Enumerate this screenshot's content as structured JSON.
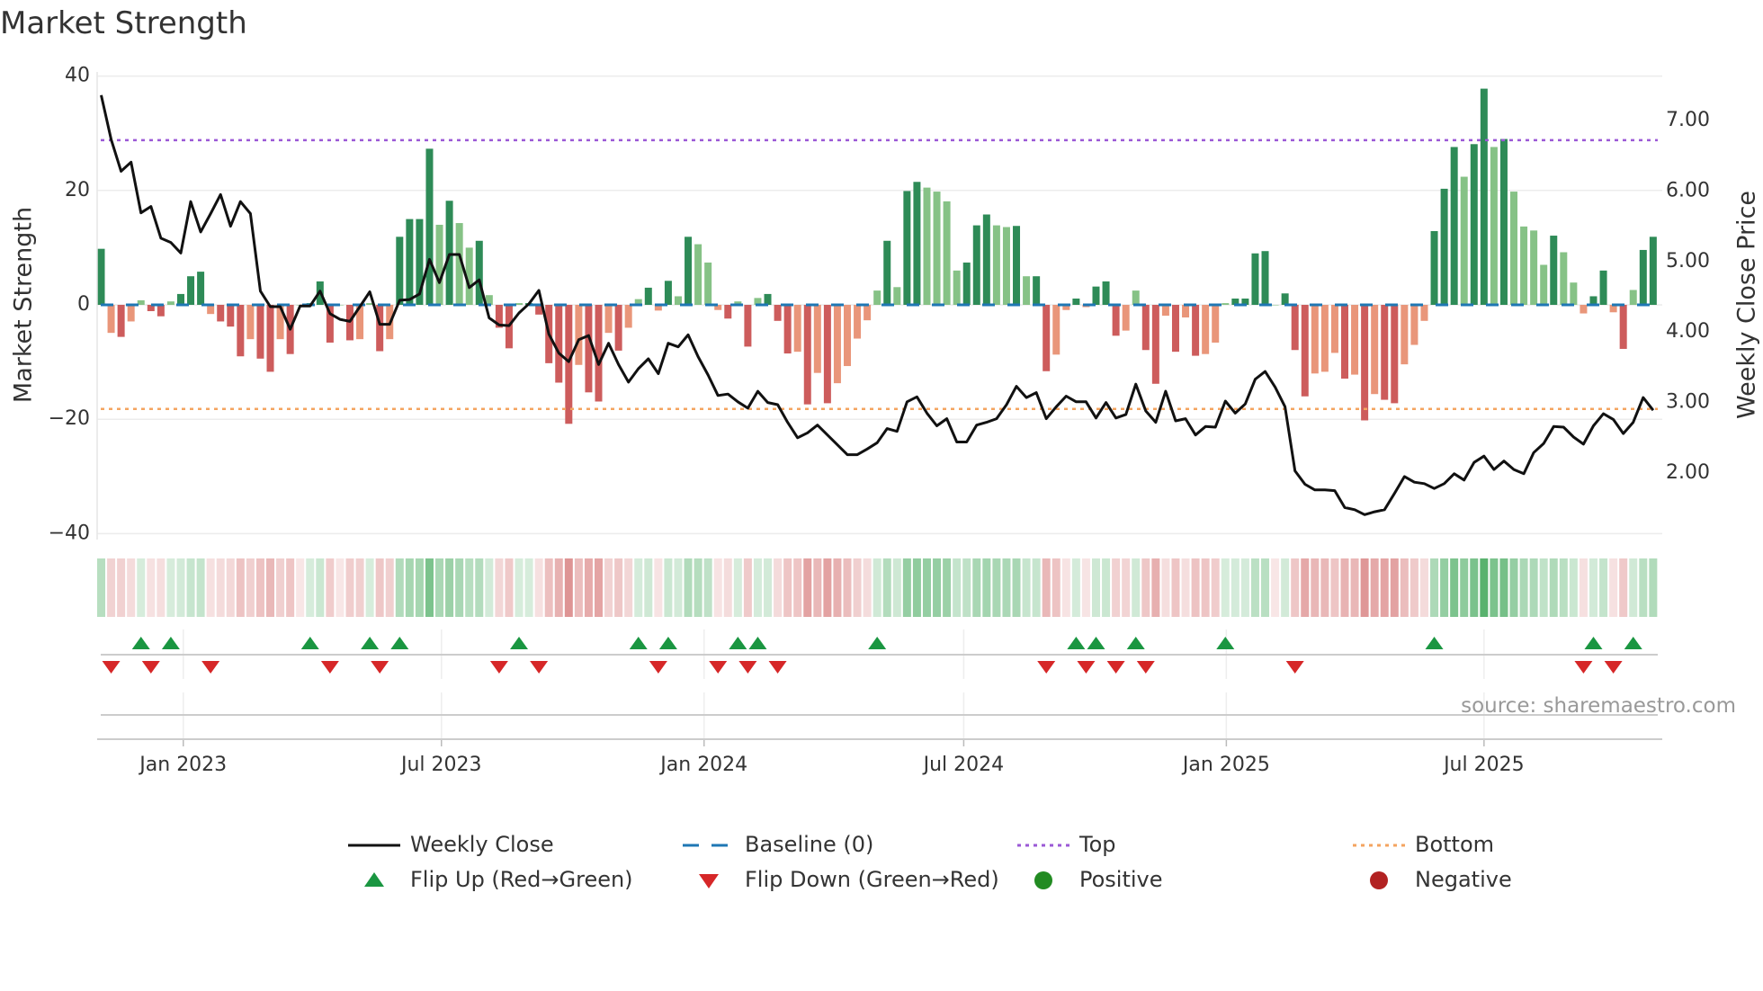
{
  "title": "Market Strength",
  "source": "source: sharemaestro.com",
  "colors": {
    "pos_dark": "#2e8b57",
    "pos_light": "#86c286",
    "neg_dark": "#cd5c5c",
    "neg_light": "#e9967a",
    "baseline": "#1f77b4",
    "top": "#9b59d6",
    "bottom": "#f4a460",
    "price": "#111111",
    "flip_up": "#1a9641",
    "flip_down": "#d62728",
    "positive": "#228b22",
    "negative": "#b22222"
  },
  "legend": [
    {
      "label": "Weekly Close",
      "kind": "line"
    },
    {
      "label": "Baseline (0)",
      "kind": "dash"
    },
    {
      "label": "Top",
      "kind": "dot-top"
    },
    {
      "label": "Bottom",
      "kind": "dot-bottom"
    },
    {
      "label": "Flip Up (Red→Green)",
      "kind": "tri-up"
    },
    {
      "label": "Flip Down (Green→Red)",
      "kind": "tri-down"
    },
    {
      "label": "Positive",
      "kind": "dot-pos"
    },
    {
      "label": "Negative",
      "kind": "dot-neg"
    }
  ],
  "chart_data": {
    "type": "bar",
    "title": "Market Strength",
    "ylabel": "Market Strength",
    "y2label": "Weekly Close Price",
    "ylim": [
      -40,
      40
    ],
    "y2lim": [
      1.0,
      7.5
    ],
    "yticks": [
      {
        "v": 40,
        "label": "40"
      },
      {
        "v": 20,
        "label": "20"
      },
      {
        "v": 0,
        "label": "0"
      },
      {
        "v": -20,
        "label": "−20"
      },
      {
        "v": -40,
        "label": "−40"
      }
    ],
    "y2ticks": [
      {
        "v": 7,
        "label": "7.00"
      },
      {
        "v": 6,
        "label": "6.00"
      },
      {
        "v": 5,
        "label": "5.00"
      },
      {
        "v": 4,
        "label": "4.00"
      },
      {
        "v": 3,
        "label": "3.00"
      },
      {
        "v": 2,
        "label": "2.00"
      }
    ],
    "xticks": [
      {
        "week": 9.25,
        "label": "Jan 2023"
      },
      {
        "week": 35.2,
        "label": "Jul 2023"
      },
      {
        "week": 61.6,
        "label": "Jan 2024"
      },
      {
        "week": 87.7,
        "label": "Jul 2024"
      },
      {
        "week": 114.1,
        "label": "Jan 2025"
      },
      {
        "week": 140.0,
        "label": "Jul 2025"
      }
    ],
    "top": 28.8,
    "bottom": -18.2,
    "baseline": 0,
    "strength": [
      9.8,
      -4.9,
      -5.6,
      -2.9,
      0.8,
      -1.1,
      -2,
      0.6,
      1.9,
      5,
      5.8,
      -1.6,
      -2.9,
      -3.8,
      -9,
      -6,
      -9.4,
      -11.7,
      -6,
      -8.6,
      0,
      0.3,
      4.1,
      -6.6,
      0,
      -6.2,
      -6,
      0.3,
      -8.1,
      -6,
      11.9,
      15,
      15,
      27.3,
      14,
      18.2,
      14.3,
      10,
      11.2,
      1.7,
      -4,
      -7.6,
      0.3,
      0.3,
      -1.7,
      -10.2,
      -13.6,
      -20.8,
      -10.5,
      -15.3,
      -16.9,
      -4.9,
      -8,
      -4,
      1,
      3,
      -1,
      4.2,
      1.5,
      11.9,
      10.6,
      7.4,
      -0.9,
      -2.4,
      0.6,
      -7.3,
      1.2,
      1.9,
      -2.8,
      -8.5,
      -8.2,
      -17.4,
      -11.9,
      -17.2,
      -13.7,
      -10.7,
      -5.9,
      -2.7,
      2.5,
      11.2,
      3.1,
      19.9,
      21.5,
      20.5,
      19.8,
      18.1,
      6,
      7.4,
      13.9,
      15.8,
      13.9,
      13.6,
      13.8,
      5,
      5,
      -11.6,
      -8.7,
      -0.9,
      1.1,
      -0.4,
      3.2,
      4.1,
      -5.4,
      -4.5,
      2.5,
      -7.9,
      -13.8,
      -1.9,
      -8.2,
      -2.2,
      -8.9,
      -8.6,
      -6.6,
      0.3,
      1.1,
      1.1,
      9,
      9.4,
      0,
      2,
      -7.9,
      -16,
      -12,
      -11.7,
      -8.4,
      -12.9,
      -12.2,
      -20.2,
      -15.6,
      -16.6,
      -17.2,
      -10.4,
      -7,
      -2.8,
      12.9,
      20.3,
      27.6,
      22.4,
      28.1,
      37.8,
      27.6,
      29,
      19.8,
      13.7,
      13,
      7,
      12.1,
      9.2,
      3.9,
      -1.5,
      1.5,
      6,
      -1.3,
      -7.7,
      2.6,
      9.6,
      11.9
    ],
    "weekly_close": [
      7.36,
      6.73,
      6.28,
      6.41,
      5.69,
      5.78,
      5.33,
      5.27,
      5.12,
      5.85,
      5.42,
      5.68,
      5.95,
      5.5,
      5.85,
      5.68,
      4.58,
      4.36,
      4.36,
      4.04,
      4.37,
      4.37,
      4.58,
      4.26,
      4.18,
      4.15,
      4.36,
      4.57,
      4.11,
      4.11,
      4.45,
      4.46,
      4.54,
      5.03,
      4.7,
      5.1,
      5.1,
      4.63,
      4.74,
      4.2,
      4.1,
      4.09,
      4.27,
      4.4,
      4.59,
      3.97,
      3.7,
      3.58,
      3.89,
      3.95,
      3.54,
      3.84,
      3.54,
      3.29,
      3.48,
      3.62,
      3.41,
      3.84,
      3.79,
      3.96,
      3.65,
      3.39,
      3.1,
      3.12,
      3.01,
      2.92,
      3.16,
      3.0,
      2.97,
      2.72,
      2.5,
      2.57,
      2.68,
      2.54,
      2.4,
      2.26,
      2.26,
      2.34,
      2.43,
      2.63,
      2.59,
      3.01,
      3.08,
      2.85,
      2.67,
      2.77,
      2.44,
      2.44,
      2.68,
      2.72,
      2.77,
      2.97,
      3.23,
      3.07,
      3.14,
      2.77,
      2.94,
      3.09,
      3.01,
      3.01,
      2.78,
      3.0,
      2.78,
      2.83,
      3.26,
      2.88,
      2.72,
      3.16,
      2.74,
      2.77,
      2.54,
      2.66,
      2.65,
      3.02,
      2.85,
      2.98,
      3.33,
      3.44,
      3.22,
      2.94,
      2.03,
      1.84,
      1.76,
      1.76,
      1.75,
      1.51,
      1.48,
      1.41,
      1.45,
      1.48,
      1.71,
      1.95,
      1.87,
      1.85,
      1.78,
      1.85,
      1.99,
      1.9,
      2.15,
      2.24,
      2.05,
      2.17,
      2.05,
      1.99,
      2.29,
      2.42,
      2.66,
      2.65,
      2.51,
      2.41,
      2.67,
      2.84,
      2.76,
      2.56,
      2.72,
      3.07,
      2.89
    ],
    "flip_up_weeks": [
      5,
      8,
      22,
      28,
      31,
      43,
      55,
      58,
      65,
      67,
      79,
      99,
      101,
      105,
      114,
      135,
      151,
      155
    ],
    "flip_down_weeks": [
      2,
      6,
      12,
      24,
      29,
      41,
      45,
      57,
      63,
      66,
      69,
      96,
      100,
      103,
      106,
      121,
      150,
      153
    ],
    "legend_placement": "bottom-center"
  }
}
